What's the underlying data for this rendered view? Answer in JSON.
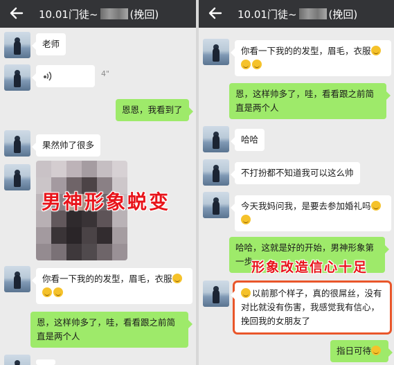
{
  "left": {
    "header": {
      "title_prefix": "10.01门徒~",
      "title_suffix": "(挽回)",
      "back_icon": "arrow-left-icon"
    },
    "messages": [
      {
        "from": "them",
        "text": "老师"
      },
      {
        "from": "them",
        "type": "voice",
        "duration": "4\""
      },
      {
        "from": "me",
        "text": "恩恩，我看到了"
      },
      {
        "from": "them",
        "text": "果然帅了很多"
      },
      {
        "from": "them",
        "type": "image",
        "overlay": "男神形象蜕变"
      },
      {
        "from": "them",
        "text": "你看一下我的的发型，眉毛，衣服"
      },
      {
        "from": "me",
        "text": "恩，这样帅多了，哇，看看跟之前简直是两个人"
      }
    ]
  },
  "right": {
    "header": {
      "title_prefix": "10.01门徒~",
      "title_suffix": "(挽回)",
      "back_icon": "arrow-left-icon"
    },
    "messages": [
      {
        "from": "them",
        "text": "你看一下我的的发型，眉毛，衣服"
      },
      {
        "from": "me",
        "text": "恩，这样帅多了，哇，看看跟之前简直是两个人"
      },
      {
        "from": "them",
        "text": "哈哈"
      },
      {
        "from": "them",
        "text": "不打扮都不知道我可以这么帅"
      },
      {
        "from": "them",
        "text": "今天我妈问我，是要去参加婚礼吗"
      },
      {
        "from": "me",
        "text": "哈哈，这就是好的开始，男神形象第一步"
      },
      {
        "from": "them",
        "text": "以前那个样子，真的很屌丝，没有对比就没有伤害，我感觉我有信心，挽回我的女朋友了"
      },
      {
        "from": "me",
        "text": "指日可待"
      }
    ],
    "overlay": "形象改造信心十足"
  },
  "colors": {
    "topbar": "#333437",
    "incoming": "#ffffff",
    "outgoing": "#9eea6a",
    "overlay_red": "#e8141b",
    "highlight": "#e9562a"
  }
}
